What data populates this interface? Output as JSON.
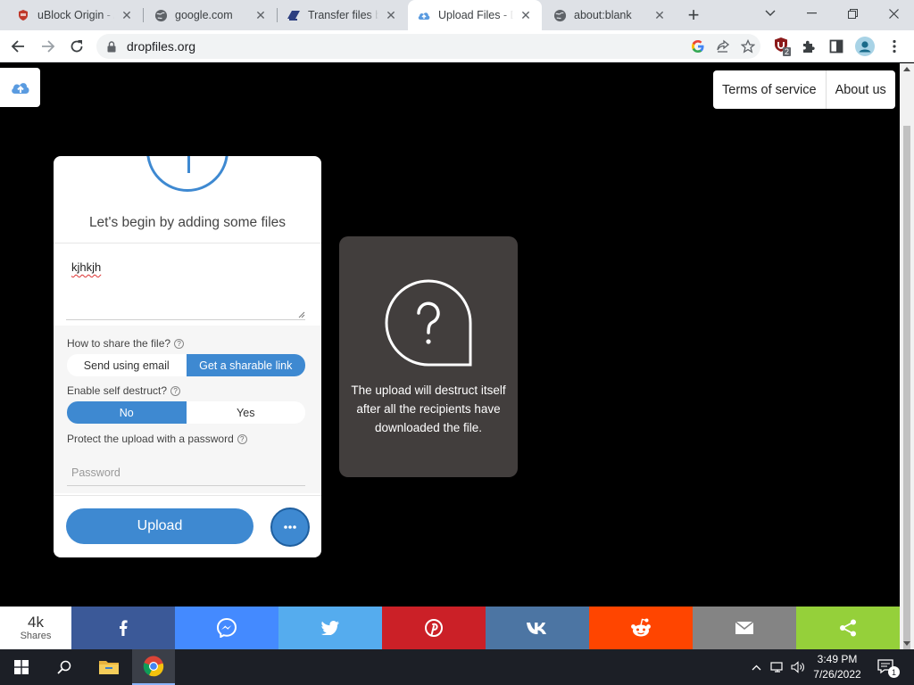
{
  "browser": {
    "tabs": [
      {
        "title": "uBlock Origin - A",
        "icon": "ublock-icon",
        "active": false
      },
      {
        "title": "google.com",
        "icon": "globe-icon",
        "active": false
      },
      {
        "title": "Transfer files be",
        "icon": "transfer-icon",
        "active": false
      },
      {
        "title": "Upload Files - D",
        "icon": "cloud-upload-icon",
        "active": true
      },
      {
        "title": "about:blank",
        "icon": "globe-icon",
        "active": false
      }
    ],
    "url": "dropfiles.org",
    "extension_badge": "2"
  },
  "header": {
    "links": [
      "Terms of service",
      "About us"
    ]
  },
  "upload": {
    "begin_text": "Let's begin by adding some files",
    "message_value": "kjhkjh",
    "share_label": "How to share the file?",
    "share_options": [
      "Send using email",
      "Get a sharable link"
    ],
    "share_selected": "Get a sharable link",
    "destruct_label": "Enable self destruct?",
    "destruct_options": [
      "No",
      "Yes"
    ],
    "destruct_selected": "No",
    "password_label": "Protect the upload with a password",
    "password_placeholder": "Password",
    "upload_label": "Upload",
    "more_label": "•••"
  },
  "info": {
    "icon": "question-bubble-icon",
    "text": "The upload will destruct itself after all the recipients have downloaded the file."
  },
  "share_bar": {
    "count": "4k",
    "count_label": "Shares",
    "buttons": [
      {
        "name": "facebook",
        "color": "#3b5998"
      },
      {
        "name": "messenger",
        "color": "#448aff"
      },
      {
        "name": "twitter",
        "color": "#55acee"
      },
      {
        "name": "pinterest",
        "color": "#cb2027"
      },
      {
        "name": "vk",
        "color": "#4c75a3"
      },
      {
        "name": "reddit",
        "color": "#ff4500"
      },
      {
        "name": "email",
        "color": "#848484"
      },
      {
        "name": "share",
        "color": "#95d03a"
      }
    ]
  },
  "taskbar": {
    "time": "3:49 PM",
    "date": "7/26/2022",
    "notification_count": "1"
  },
  "colors": {
    "accent": "#3e89d1",
    "info_card": "#423e3d",
    "page_bg": "#000000"
  }
}
